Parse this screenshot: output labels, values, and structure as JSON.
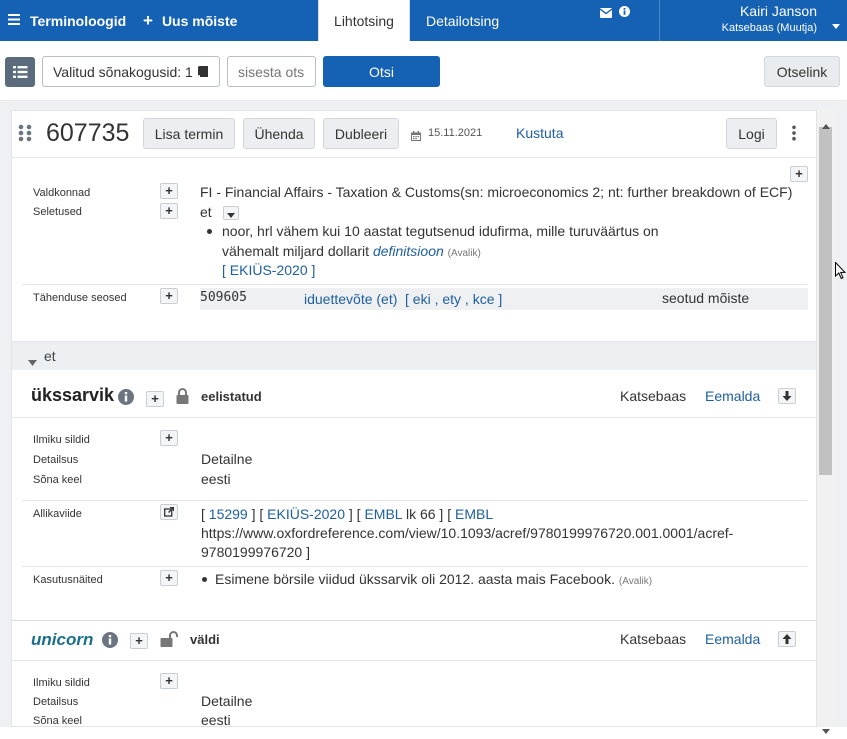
{
  "topbar": {
    "app_title": "Terminoloogid",
    "new_concept": "Uus mõiste",
    "tabs": [
      {
        "label": "Lihtotsing"
      },
      {
        "label": "Detailotsing"
      }
    ],
    "user_name": "Kairi Janson",
    "user_role": "Katsebaas (Muutja)"
  },
  "search": {
    "datasets_label": "Valitud sõnakogusid: 1",
    "input_placeholder": "sisesta otsi",
    "search_button": "Otsi",
    "direct_link": "Otselink"
  },
  "concept": {
    "id": "607735",
    "buttons": {
      "add_term": "Lisa termin",
      "join": "Ühenda",
      "duplicate": "Dubleeri",
      "delete": "Kustuta",
      "log": "Logi"
    },
    "date": "15.11.2021",
    "labels": {
      "domains": "Valdkonnad",
      "definitions": "Seletused",
      "relations": "Tähenduse seosed"
    },
    "domain_value": "FI - Financial Affairs - Taxation & Customs(sn: microeconomics 2; nt: further breakdown of ECF)",
    "definition_lang": "et",
    "definition_line1": "noor, hrl vähem kui 10 aastat tegutsenud idufirma, mille turuväärtus on",
    "definition_line2": "vähemalt miljard dollarit",
    "definition_link": "definitsioon",
    "definition_public": "(Avalik)",
    "definition_source": "[ EKIÜS-2020 ]",
    "relation": {
      "id": "509605",
      "term": "iduettevõte (et)",
      "refs": "[ eki , ety , kce ]",
      "type": "seotud mõiste"
    }
  },
  "lang_section": {
    "label": "et"
  },
  "terms": [
    {
      "word": "ükssarvik",
      "status": "eelistatud",
      "dataset": "Katsebaas",
      "remove": "Eemalda",
      "labels": {
        "tags": "Ilmiku sildid",
        "detail": "Detailsus",
        "lang": "Sõna keel",
        "source": "Allikaviide",
        "usage": "Kasutusnäited"
      },
      "detail_value": "Detailne",
      "lang_value": "eesti",
      "source_1": "15299",
      "source_2": "EKIÜS-2020",
      "source_3": "EMBL",
      "source_3_suffix": "lk 66 ]",
      "source_4": "EMBL",
      "source_url_1": "https://www.oxfordreference.com/view/10.1093/acref/9780199976720.001.0001/acref-",
      "source_url_2": "9780199976720",
      "usage_value": "Esimene börsile viidud ükssarvik oli 2012. aasta mais Facebook.",
      "usage_public": "(Avalik)"
    },
    {
      "word": "unicorn",
      "status": "väldi",
      "dataset": "Katsebaas",
      "remove": "Eemalda",
      "labels": {
        "tags": "Ilmiku sildid",
        "detail": "Detailsus",
        "lang": "Sõna keel"
      },
      "detail_value": "Detailne",
      "lang_value": "eesti"
    }
  ],
  "colors": {
    "primary": "#1561b3",
    "link": "#1f5fa0",
    "accent_word": "#1a6f8a"
  }
}
